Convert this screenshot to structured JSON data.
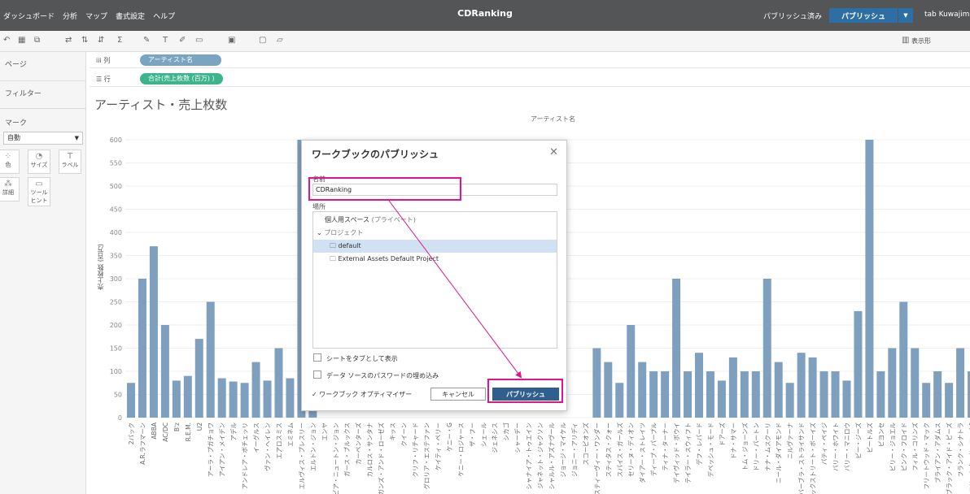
{
  "menu": [
    "ダッシュボード",
    "分析",
    "マップ",
    "書式設定",
    "ヘルプ"
  ],
  "workbook_title": "CDRanking",
  "status_published": "パブリッシュ済み",
  "publish_button": "パブリッシュ",
  "user_name": "tab Kuwajima",
  "toolbar": {
    "show_me": "表示形"
  },
  "left_panel": {
    "pages": "ページ",
    "filters": "フィルター",
    "marks": "マーク",
    "mark_type": "自動",
    "mark_buttons": [
      "色",
      "サイズ",
      "ラベル",
      "詳細",
      "ツールヒント"
    ]
  },
  "shelves": {
    "columns_label": "列",
    "columns_pill": "アーティスト名",
    "rows_label": "行",
    "rows_pill": "合計(売上枚数 (百万) )"
  },
  "sheet": {
    "title": "アーティスト・売上枚数",
    "header_field": "アーティスト名"
  },
  "chart_data": {
    "type": "bar",
    "ylabel": "売上枚数 (百万)",
    "ylim": [
      0,
      600
    ],
    "yticks": [
      0,
      50,
      100,
      150,
      200,
      250,
      300,
      350,
      400,
      450,
      500,
      550,
      600
    ],
    "bar_color": "#7f9fbf",
    "categories": [
      "2パック",
      "A.R.ラフマーン",
      "ABBA",
      "AC/DC",
      "B'z",
      "R.E.M.",
      "U2",
      "アーラ・プガチョワ",
      "アイアン・メイデン",
      "アデル",
      "アンドレア・ボチェッリ",
      "イーグルス",
      "ヴァン・ヘイレン",
      "エアロスミス",
      "エミネム",
      "エルヴィス・プレスリー",
      "エルトン・ジョン",
      "エンヤ",
      "オリビア・ニュートン・ジョン",
      "ガース・ブルックス",
      "カーペンターズ",
      "カルロス・サンタナ",
      "ガンズ・アンド・ローゼズ",
      "キッス",
      "クイーン",
      "クリフ・リチャード",
      "グロリア・エステファン",
      "ケイティ・ペリー",
      "ケニー・G",
      "ケニー・ロジャース",
      "ザ・フー",
      "シェール",
      "ジェネシス",
      "シカゴ",
      "シャーデー",
      "シャナイア・トゥエイン",
      "ジャネット・ジャクソン",
      "シャルル・アズナヴール",
      "ジョージ・マイケル",
      "ジョニー・アリディ",
      "スコーピオンズ",
      "スティーヴィー・ワンダー",
      "スティタス・クォー",
      "スパイス・ガールズ",
      "セリーヌ・ディオン",
      "ダイアー・ストレイツ",
      "ディープ・パープル",
      "ティナ・ターナー",
      "デイヴィッド・ボウイ",
      "テイラー・スウィフト",
      "デフ・レパード",
      "デペッシュ・モード",
      "ドアーズ",
      "ドナ・サマー",
      "トム・ジョーンズ",
      "ドリー・パートン",
      "ナナ・ムスクーリ",
      "ニール・ダイアモンド",
      "ニルヴァーナ",
      "バーブラ・ストライサンド",
      "バックストリート・ボーイズ",
      "パティ・ペイジ",
      "バリー・ホワイト",
      "バリー・マニロウ",
      "ビー・ジーズ",
      "ビートルズ",
      "ビヨンセ",
      "ビリー・ジョエル",
      "ピンク・フロイド",
      "フィル・コリンズ",
      "フリートウッド・マック",
      "ブライアン・アダムス",
      "ブラック・アイド・ピーズ",
      "フランク・シナトラ",
      "フリートウッド・マックⅡ",
      "フリオ・イグレシアス",
      "ブリトニー・スピアーズ",
      "プリンス"
    ],
    "values": [
      75,
      300,
      370,
      200,
      80,
      90,
      170,
      250,
      85,
      78,
      75,
      120,
      80,
      150,
      85,
      600,
      300,
      0,
      0,
      0,
      0,
      0,
      0,
      0,
      0,
      0,
      0,
      0,
      0,
      0,
      0,
      0,
      0,
      0,
      0,
      0,
      0,
      0,
      0,
      0,
      0,
      150,
      120,
      75,
      200,
      120,
      100,
      100,
      300,
      100,
      140,
      100,
      80,
      130,
      100,
      100,
      300,
      120,
      75,
      140,
      130,
      100,
      100,
      80,
      230,
      600,
      100,
      150,
      250,
      150,
      75,
      100,
      75,
      150,
      100,
      300,
      100,
      80
    ]
  },
  "dialog": {
    "title": "ワークブックのパブリッシュ",
    "name_label": "名前",
    "name_value": "CDRanking",
    "location_label": "場所",
    "locations": [
      {
        "label": "個人用スペース",
        "sub": "(プライベート)"
      },
      {
        "label": "プロジェクト"
      },
      {
        "label": "default"
      },
      {
        "label": "External Assets Default Project"
      }
    ],
    "option_tabs": "シートをタブとして表示",
    "option_password": "データ ソースのパスワードの埋め込み",
    "optimizer": "ワークブック オプティマイザー",
    "cancel": "キャンセル",
    "publish": "パブリッシュ"
  },
  "colors": {
    "topbar": "#545556",
    "accent": "#2d6ea5",
    "highlight": "#e3138c",
    "bar": "#7f9fbf"
  }
}
